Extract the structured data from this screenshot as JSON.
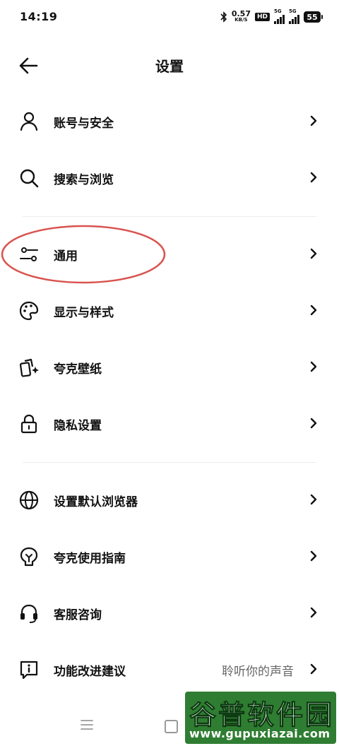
{
  "status_bar": {
    "time": "14:19",
    "net_speed": "0.57",
    "net_unit": "KB/S",
    "hd_label": "HD",
    "sim1_tag": "5G",
    "sim2_tag": "5G",
    "battery": "55"
  },
  "header": {
    "title": "设置"
  },
  "menu": {
    "items": [
      {
        "label": "账号与安全",
        "icon": "user-icon"
      },
      {
        "label": "搜索与浏览",
        "icon": "search-icon"
      },
      {
        "label": "通用",
        "icon": "sliders-icon"
      },
      {
        "label": "显示与样式",
        "icon": "palette-icon"
      },
      {
        "label": "夸克壁纸",
        "icon": "wallpaper-icon"
      },
      {
        "label": "隐私设置",
        "icon": "lock-icon"
      },
      {
        "label": "设置默认浏览器",
        "icon": "globe-icon"
      },
      {
        "label": "夸克使用指南",
        "icon": "guide-bulb-icon"
      },
      {
        "label": "客服咨询",
        "icon": "headset-icon"
      },
      {
        "label": "功能改进建议",
        "icon": "feedback-icon",
        "extra": "聆听你的声音"
      }
    ]
  },
  "watermark": {
    "title": "谷普软件园",
    "url": "www.gupuxiazai.com"
  },
  "colors": {
    "highlight": "#d9534f",
    "divider": "#ececec",
    "watermark_bg": "#2f7d32"
  }
}
